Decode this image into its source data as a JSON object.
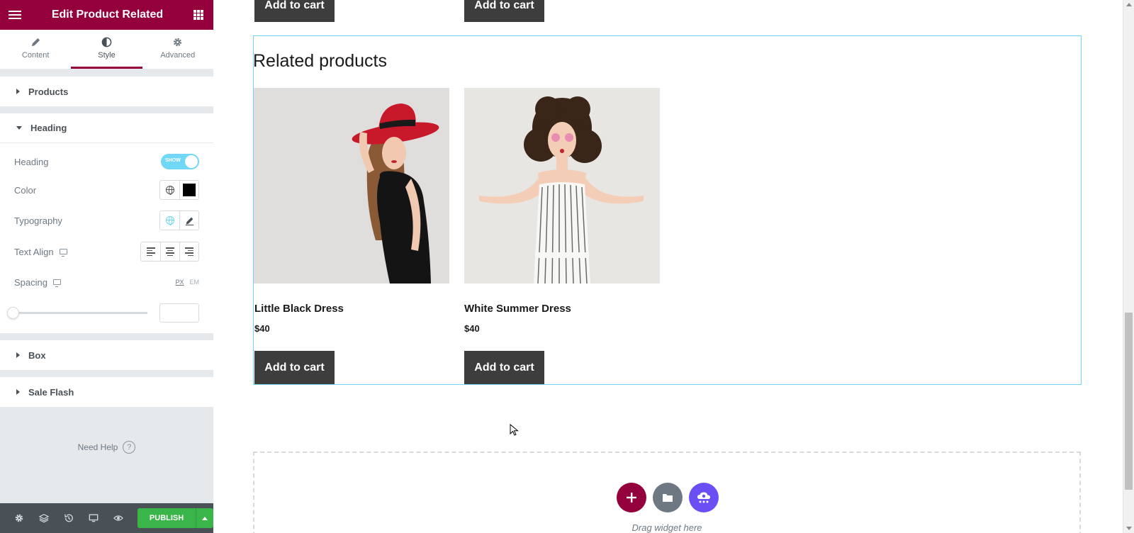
{
  "panel": {
    "title": "Edit Product Related",
    "tabs": [
      {
        "label": "Content",
        "icon": "pencil-icon"
      },
      {
        "label": "Style",
        "icon": "half-circle-icon"
      },
      {
        "label": "Advanced",
        "icon": "gear-icon"
      }
    ],
    "active_tab": "Style",
    "sections": {
      "products": "Products",
      "heading": "Heading",
      "box": "Box",
      "sale_flash": "Sale Flash"
    },
    "heading_controls": {
      "heading_label": "Heading",
      "heading_toggle": "SHOW",
      "color_label": "Color",
      "color_value": "#000000",
      "typography_label": "Typography",
      "text_align_label": "Text Align",
      "spacing_label": "Spacing",
      "unit_px": "PX",
      "unit_em": "EM",
      "spacing_value": ""
    },
    "need_help": "Need Help",
    "publish_label": "PUBLISH",
    "brand_color": "#93003c",
    "publish_color": "#39b54a"
  },
  "preview": {
    "add_to_cart": "Add to cart",
    "related_title": "Related products",
    "products": [
      {
        "name": "Little Black Dress",
        "price": "$40"
      },
      {
        "name": "White Summer Dress",
        "price": "$40"
      }
    ],
    "drag_widget": "Drag widget here"
  }
}
